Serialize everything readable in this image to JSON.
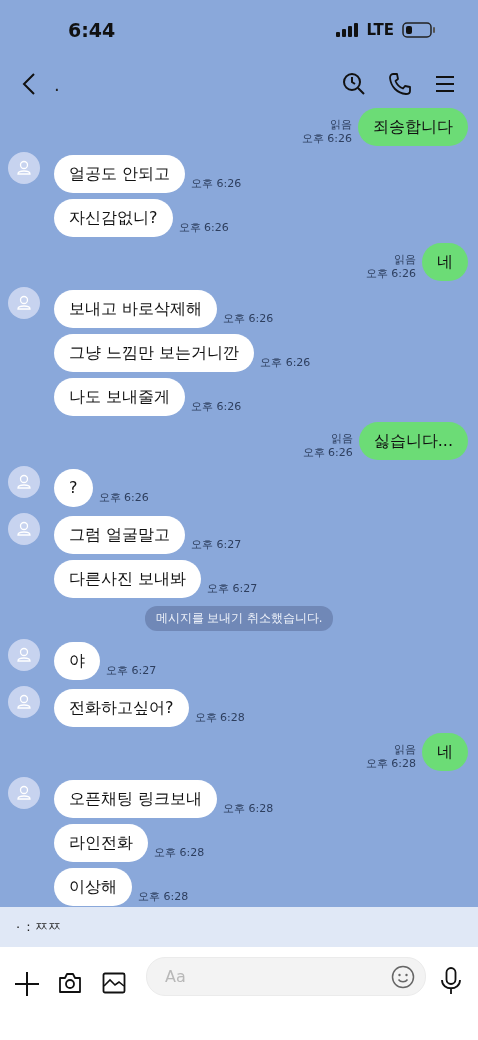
{
  "status_bar": {
    "time": "6:44",
    "network": "LTE"
  },
  "header": {
    "title": "."
  },
  "messages": [
    {
      "kind": "out",
      "text": "죄송합니다",
      "read": "읽음",
      "time": "오후 6:26"
    },
    {
      "kind": "in",
      "show_avatar": true,
      "text": "얼공도 안되고",
      "time": "오후 6:26"
    },
    {
      "kind": "in",
      "show_avatar": false,
      "text": "자신감없니?",
      "time": "오후 6:26"
    },
    {
      "kind": "out",
      "text": "네",
      "read": "읽음",
      "time": "오후 6:26"
    },
    {
      "kind": "in",
      "show_avatar": true,
      "text": "보내고 바로삭제해",
      "time": "오후 6:26"
    },
    {
      "kind": "in",
      "show_avatar": false,
      "text": "그냥 느낌만 보는거니깐",
      "time": "오후 6:26"
    },
    {
      "kind": "in",
      "show_avatar": false,
      "text": "나도 보내줄게",
      "time": "오후 6:26"
    },
    {
      "kind": "out",
      "text": "싫습니다...",
      "read": "읽음",
      "time": "오후 6:26"
    },
    {
      "kind": "in",
      "show_avatar": true,
      "text": "?",
      "time": "오후 6:26"
    },
    {
      "kind": "in",
      "show_avatar": true,
      "text": "그럼 얼굴말고",
      "time": "오후 6:27"
    },
    {
      "kind": "in",
      "show_avatar": false,
      "text": "다른사진 보내봐",
      "time": "오후 6:27"
    },
    {
      "kind": "system",
      "text": "메시지를 보내기 취소했습니다."
    },
    {
      "kind": "in",
      "show_avatar": true,
      "text": "야",
      "time": "오후 6:27"
    },
    {
      "kind": "in",
      "show_avatar": true,
      "text": "전화하고싶어?",
      "time": "오후 6:28"
    },
    {
      "kind": "out",
      "text": "네",
      "read": "읽음",
      "time": "오후 6:28"
    },
    {
      "kind": "in",
      "show_avatar": true,
      "text": "오픈채팅 링크보내",
      "time": "오후 6:28"
    },
    {
      "kind": "in",
      "show_avatar": false,
      "text": "라인전화",
      "time": "오후 6:28"
    },
    {
      "kind": "in",
      "show_avatar": false,
      "text": "이상해",
      "time": "오후 6:28"
    }
  ],
  "notification": {
    "sender": "·",
    "text": ": ㅉㅉ"
  },
  "composer": {
    "placeholder": "Aa"
  }
}
